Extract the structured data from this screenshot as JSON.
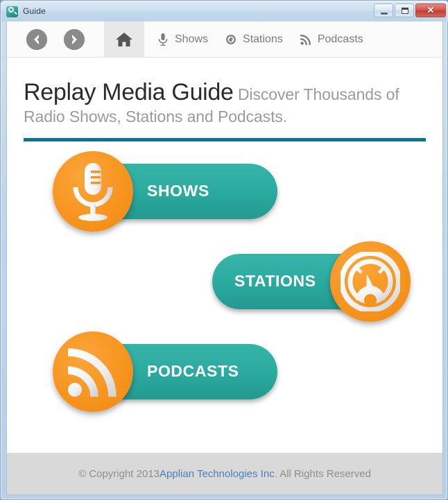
{
  "window": {
    "title": "Guide",
    "app_icon": "magnifier-icon",
    "controls": {
      "minimize": "minimize-button",
      "maximize": "maximize-button",
      "close_label": "✕"
    }
  },
  "toolbar": {
    "back": {
      "name": "back-button",
      "icon": "chevron-left-icon"
    },
    "forward": {
      "name": "forward-button",
      "icon": "chevron-right-icon"
    },
    "home": {
      "name": "home-button",
      "icon": "home-icon",
      "active": true
    },
    "items": [
      {
        "label": "Shows",
        "icon": "microphone-icon"
      },
      {
        "label": "Stations",
        "icon": "tuner-dial-icon"
      },
      {
        "label": "Podcasts",
        "icon": "rss-icon"
      }
    ]
  },
  "headline": {
    "main": "Replay Media Guide",
    "sub": " Discover Thousands of Radio Shows, Stations and Podcasts."
  },
  "buttons": [
    {
      "label": "SHOWS",
      "icon": "microphone-icon",
      "icon_side": "left"
    },
    {
      "label": "STATIONS",
      "icon": "tuner-dial-icon",
      "icon_side": "right"
    },
    {
      "label": "PODCASTS",
      "icon": "rss-icon",
      "icon_side": "left"
    }
  ],
  "footer": {
    "prefix": "© Copyright 2013 ",
    "link": "Applian Technologies Inc",
    "suffix": ". All Rights Reserved"
  },
  "colors": {
    "orange": "#f7941e",
    "teal": "#2aaa9f",
    "rule": "#0c7391",
    "link": "#4a7ebb",
    "footer_bg": "#d9d9d9",
    "toolbar_icon": "#7b7b7b"
  }
}
